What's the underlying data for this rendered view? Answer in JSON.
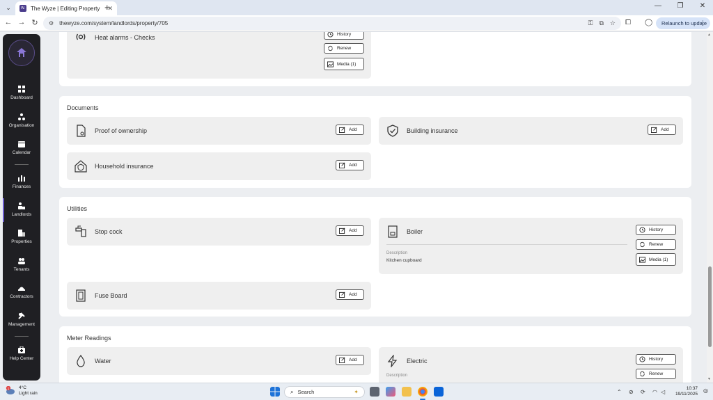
{
  "browser": {
    "tab_title": "The Wyze | Editing Property",
    "favicon_text": "W.",
    "url": "thewyze.com/system/landlords/property/705",
    "relaunch_label": "Relaunch to update"
  },
  "sidebar": {
    "items": [
      {
        "label": "Dashboard",
        "icon": "dashboard-icon"
      },
      {
        "label": "Organisation",
        "icon": "organisation-icon"
      },
      {
        "label": "Calendar",
        "icon": "calendar-icon"
      },
      {
        "label": "Finances",
        "icon": "finances-icon"
      },
      {
        "label": "Landlords",
        "icon": "landlords-icon"
      },
      {
        "label": "Properties",
        "icon": "properties-icon"
      },
      {
        "label": "Tenants",
        "icon": "tenants-icon"
      },
      {
        "label": "Contractors",
        "icon": "contractors-icon"
      },
      {
        "label": "Management",
        "icon": "management-icon"
      },
      {
        "label": "Help Center",
        "icon": "help-center-icon"
      }
    ],
    "active": "Landlords"
  },
  "sections": {
    "top": {
      "card": {
        "label": "Heat alarms - Checks",
        "history": "History",
        "renew": "Renew",
        "media": "Media (1)"
      }
    },
    "documents": {
      "title": "Documents",
      "cards": [
        {
          "label": "Proof of ownership",
          "button": "Add"
        },
        {
          "label": "Building insurance",
          "button": "Add"
        },
        {
          "label": "Household insurance",
          "button": "Add"
        }
      ]
    },
    "utilities": {
      "title": "Utilities",
      "stop_cock": {
        "label": "Stop cock",
        "button": "Add"
      },
      "boiler": {
        "label": "Boiler",
        "history": "History",
        "renew": "Renew",
        "media": "Media (1)",
        "description_label": "Description",
        "description_value": "Kitchen cupboard"
      },
      "fuse_board": {
        "label": "Fuse Board",
        "button": "Add"
      }
    },
    "meter_readings": {
      "title": "Meter Readings",
      "water": {
        "label": "Water",
        "button": "Add"
      },
      "electric": {
        "label": "Electric",
        "history": "History",
        "renew": "Renew",
        "description_label": "Description"
      }
    }
  },
  "taskbar": {
    "weather_temp": "4°C",
    "weather_desc": "Light rain",
    "weather_badge": "1",
    "search_placeholder": "Search",
    "time": "10:37",
    "date": "19/11/2025"
  },
  "colors": {
    "sidebar_bg": "#1f1f23",
    "accent": "#6a5acd",
    "card_bg": "#efefef"
  }
}
